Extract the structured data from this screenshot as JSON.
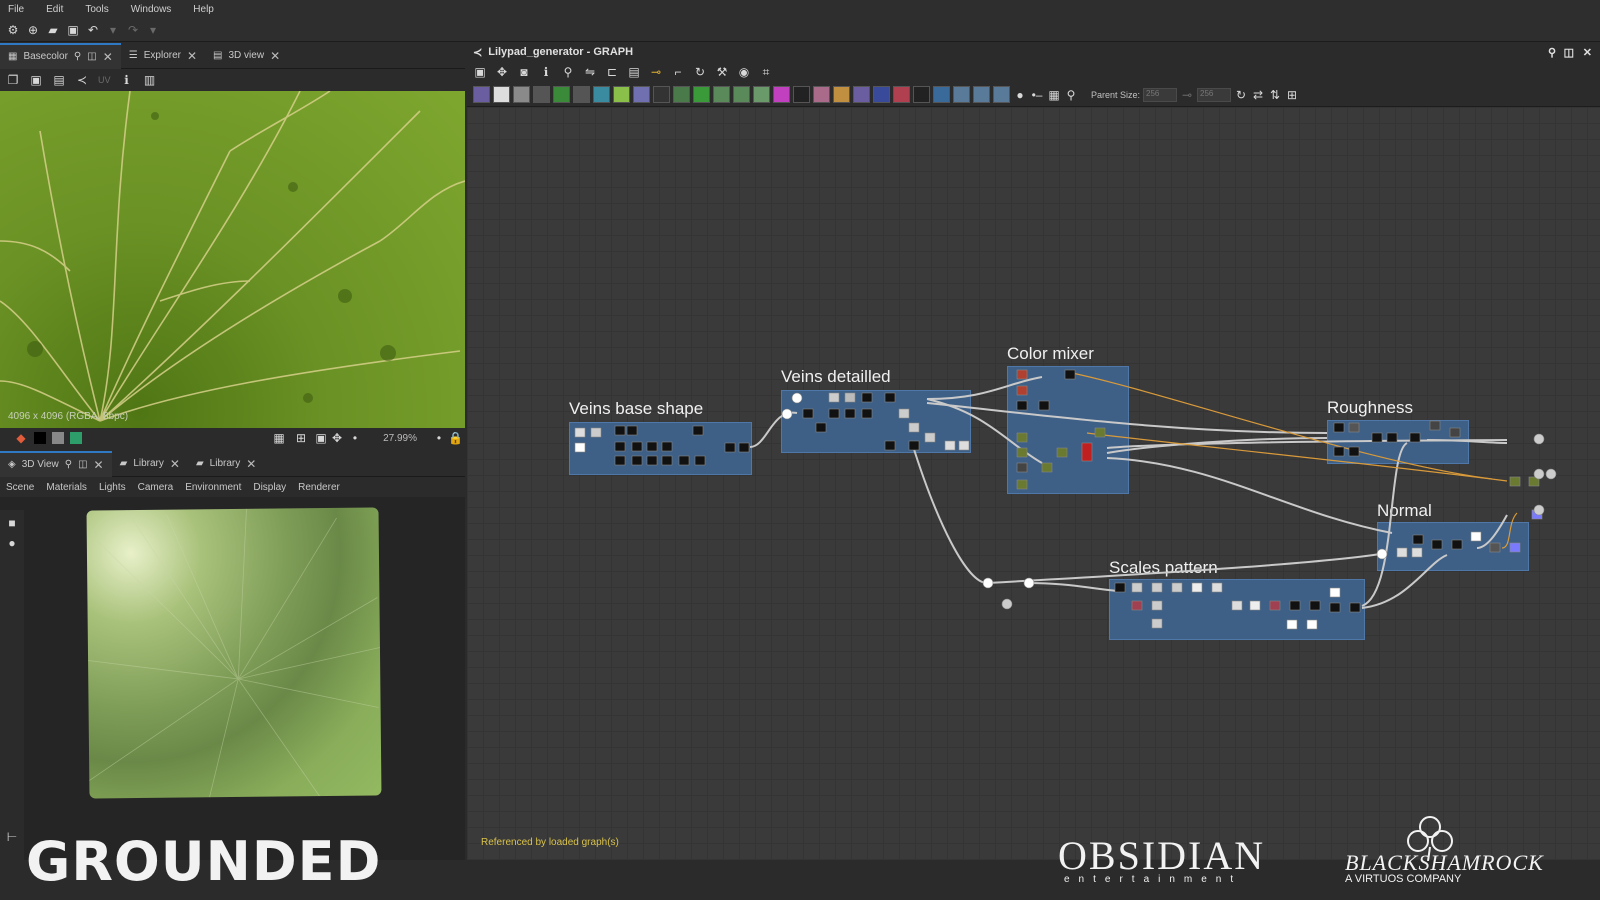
{
  "menu": [
    "File",
    "Edit",
    "Tools",
    "Windows",
    "Help"
  ],
  "top_panel": {
    "tabs": [
      {
        "label": "Basecolor",
        "active": true
      },
      {
        "label": "Explorer",
        "active": false
      },
      {
        "label": "3D view",
        "active": false
      }
    ],
    "sub_tool_uv": "UV",
    "image_info": "4096 x 4096 (RGBA, 8bpc)",
    "zoom": "27.99%"
  },
  "bottom_panel": {
    "tabs": [
      {
        "label": "3D View",
        "active": true
      },
      {
        "label": "Library",
        "active": false
      },
      {
        "label": "Library",
        "active": false
      }
    ],
    "menu": [
      "Scene",
      "Materials",
      "Lights",
      "Camera",
      "Environment",
      "Display",
      "Renderer"
    ]
  },
  "graph": {
    "title": "Lilypad_generator - GRAPH",
    "parent_size_label": "Parent Size:",
    "parent_size_value": "256",
    "parent_size_value2": "256",
    "frames": [
      {
        "label": "Veins base shape"
      },
      {
        "label": "Veins detailled"
      },
      {
        "label": "Color mixer"
      },
      {
        "label": "Roughness"
      },
      {
        "label": "Normal"
      },
      {
        "label": "Scales pattern"
      }
    ],
    "status": "Referenced by loaded graph(s)"
  },
  "branding": {
    "game": "GROUNDED",
    "studio": "OBSIDIAN",
    "studio_sub": "entertainment",
    "partner": "BLACKSHAMROCK",
    "partner_sub": "A VIRTUOS COMPANY"
  },
  "colors": {
    "accent": "#2f78c4",
    "frame_bg": "#3e5f86",
    "status_text": "#d9c24a",
    "leaf_green": "#7ea72f"
  }
}
